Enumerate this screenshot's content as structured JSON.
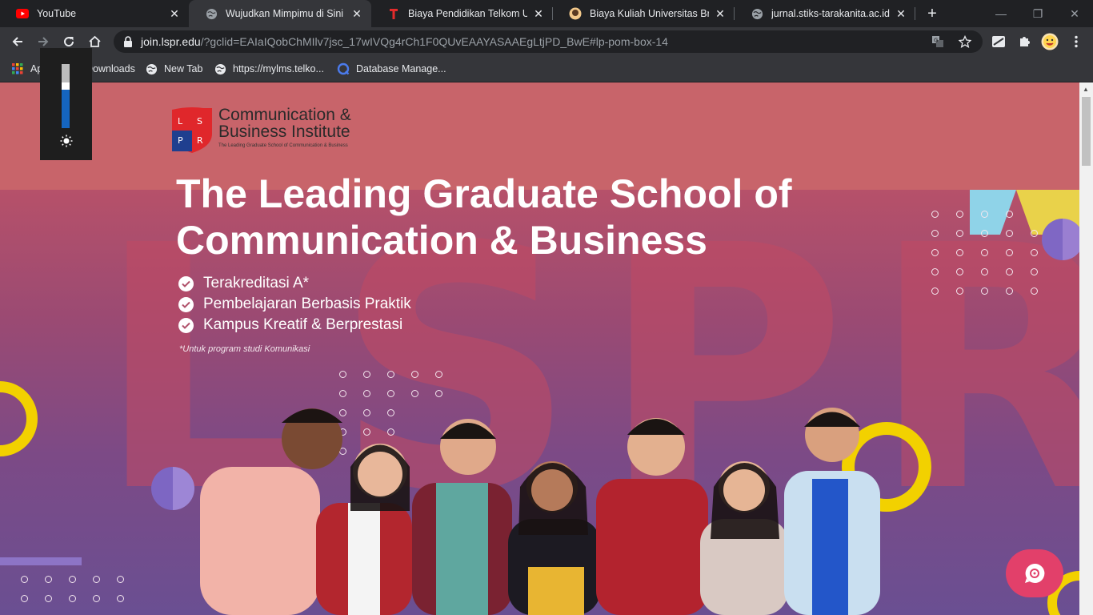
{
  "tabs": [
    {
      "title": "YouTube",
      "icon": "youtube-icon"
    },
    {
      "title": "Wujudkan Mimpimu di Sini | Lo",
      "icon": "globe-icon",
      "active": true
    },
    {
      "title": "Biaya Pendidikan Telkom Unive",
      "icon": "telkom-icon"
    },
    {
      "title": "Biaya Kuliah Universitas Brawija",
      "icon": "brawijaya-icon"
    },
    {
      "title": "jurnal.stiks-tarakanita.ac.id",
      "icon": "globe-icon"
    }
  ],
  "toolbar": {
    "url_host": "join.lspr.edu",
    "url_path": "/?gclid=EAIaIQobChMIlv7jsc_17wIVQg4rCh1F0QUvEAAYASAAEgLtjPD_BwE#lp-pom-box-14"
  },
  "bookmarks": [
    {
      "label": "Apps",
      "icon": "apps-icon"
    },
    {
      "label": "Downloads",
      "icon": "folder-icon"
    },
    {
      "label": "New Tab",
      "icon": "globe-icon"
    },
    {
      "label": "https://mylms.telko...",
      "icon": "globe-icon"
    },
    {
      "label": "Database Manage...",
      "icon": "database-icon"
    }
  ],
  "brightness": {
    "level": 0.6
  },
  "page": {
    "logo": {
      "letters": [
        "L",
        "S",
        "P",
        "R"
      ],
      "line1": "Communication &",
      "line2": "Business Institute",
      "tagline": "The Leading Graduate School of Communication & Business"
    },
    "bigletters": "LSPR",
    "headline_1": "The Leading Graduate School of",
    "headline_2": "Communication & Business",
    "bullets": [
      "Terakreditasi A*",
      "Pembelajaran Berbasis Praktik",
      "Kampus Kreatif & Berprestasi"
    ],
    "footnote": "*Untuk program studi Komunikasi"
  },
  "colors": {
    "brand_red": "#c8646a",
    "accent_yellow": "#f2d100",
    "chat_button": "#e2406a"
  }
}
